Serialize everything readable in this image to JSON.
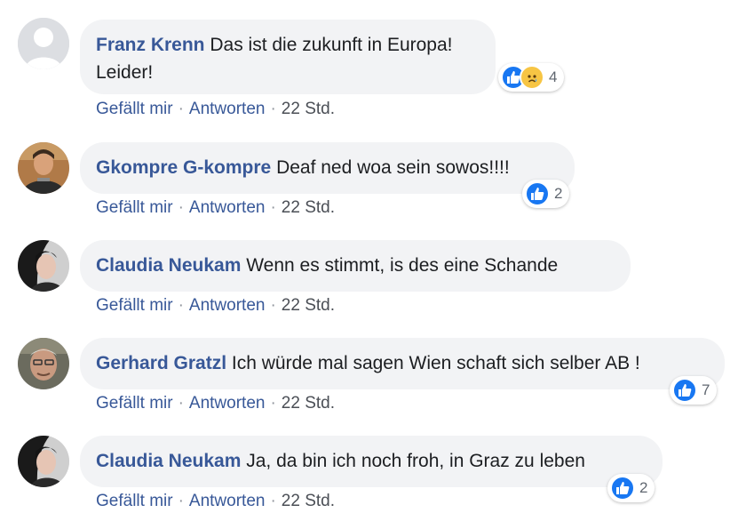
{
  "comments": [
    {
      "author": "Franz Krenn",
      "text": "Das ist die zukunft in Europa!",
      "text2": "Leider!",
      "reaction_icons": [
        "like-icon",
        "sad-icon"
      ],
      "reaction_count": "4",
      "like_label": "Gefällt mir",
      "reply_label": "Antworten",
      "time": "22 Std."
    },
    {
      "author": "Gkompre G-kompre",
      "text": "Deaf ned woa sein sowos!!!!",
      "reaction_icons": [
        "like-icon"
      ],
      "reaction_count": "2",
      "like_label": "Gefällt mir",
      "reply_label": "Antworten",
      "time": "22 Std."
    },
    {
      "author": "Claudia Neukam",
      "text": "Wenn es stimmt, is des eine Schande",
      "like_label": "Gefällt mir",
      "reply_label": "Antworten",
      "time": "22 Std."
    },
    {
      "author": "Gerhard Gratzl",
      "text": "Ich würde mal sagen Wien schaft sich selber AB !",
      "reaction_icons": [
        "like-icon"
      ],
      "reaction_count": "7",
      "like_label": "Gefällt mir",
      "reply_label": "Antworten",
      "time": "22 Std."
    },
    {
      "author": "Claudia Neukam",
      "text": "Ja, da bin ich noch froh, in Graz zu leben",
      "reaction_icons": [
        "like-icon"
      ],
      "reaction_count": "2",
      "like_label": "Gefällt mir",
      "reply_label": "Antworten",
      "time": "22 Std."
    }
  ],
  "separator": "·",
  "colors": {
    "author_link": "#385898",
    "bubble_bg": "#f2f3f5",
    "like_blue": "#1877f2",
    "sad_yellow": "#f7c544",
    "meta_text": "#4b4f56"
  }
}
